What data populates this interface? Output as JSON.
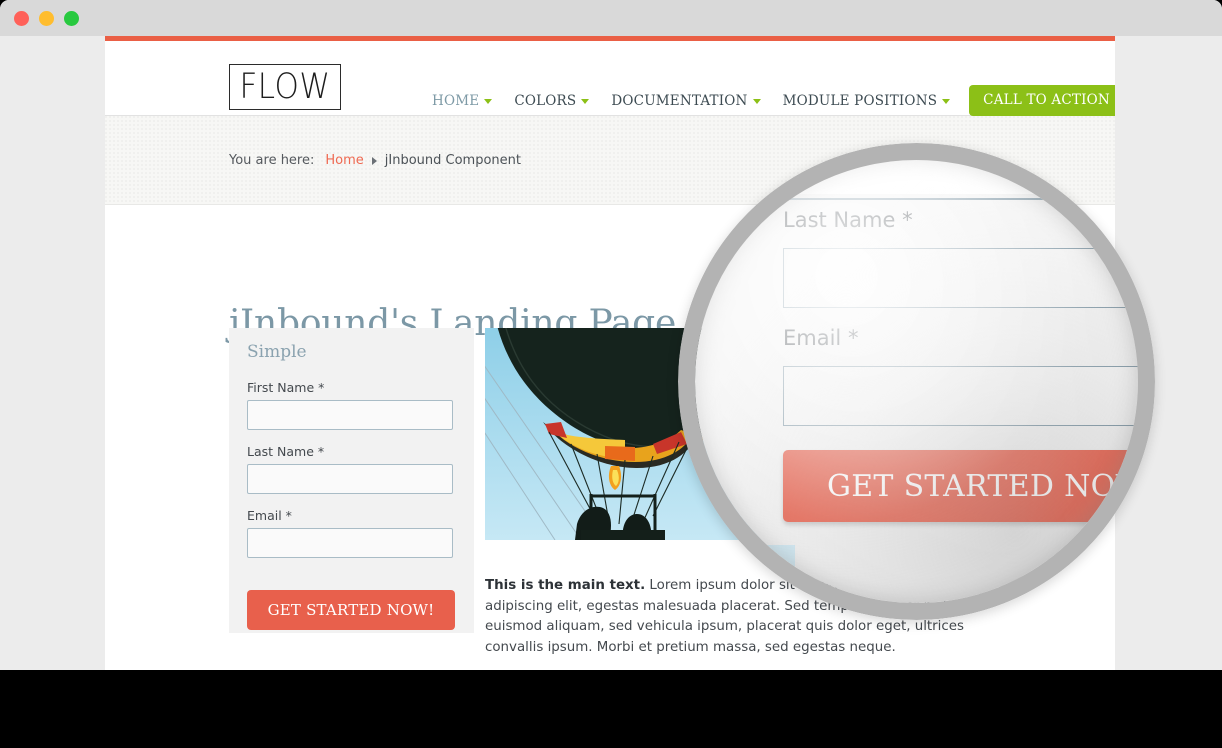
{
  "window": {
    "traffic_lights": [
      {
        "name": "close-button",
        "color": "#ff6159"
      },
      {
        "name": "minimize-button",
        "color": "#ffbd2e"
      },
      {
        "name": "maximize-button",
        "color": "#28c93f"
      }
    ]
  },
  "colors": {
    "accent_orange": "#ea5f45",
    "accent_orange_button": "#e8604c",
    "accent_green": "#8cc017",
    "heading_blue": "#7c98a6",
    "input_border": "#a9bcc6",
    "lens_ring": "#b3b3b3",
    "page_bg": "#ffffff",
    "card_bg": "#f2f2f2",
    "band_bg": "#f7f7f5"
  },
  "header": {
    "logo_text": "FLOW",
    "nav": [
      {
        "label": "HOME",
        "has_caret": true,
        "active": true
      },
      {
        "label": "COLORS",
        "has_caret": true,
        "active": false
      },
      {
        "label": "DOCUMENTATION",
        "has_caret": true,
        "active": false
      },
      {
        "label": "MODULE POSITIONS",
        "has_caret": true,
        "active": false
      }
    ],
    "cta_label": "CALL TO ACTION"
  },
  "breadcrumb": {
    "lead": "You are here:",
    "link": "Home",
    "current": "jInbound Component"
  },
  "main": {
    "page_title": "jInbound's Landing Page",
    "body_copy_lead": "This is the main text.",
    "body_copy": " Lorem ipsum dolor sit amet, consectetur adipiscing elit, egestas malesuada placerat. Sed tempor lacus et nisl euismod aliquam, sed vehicula ipsum, placerat quis dolor eget, ultrices convallis ipsum. Morbi et pretium massa, sed egestas neque.",
    "hero_image_alt": "hot-air-balloon-photo"
  },
  "form": {
    "heading": "Simple",
    "fields": [
      {
        "label": "First Name",
        "required_mark": "*",
        "value": "",
        "placeholder": ""
      },
      {
        "label": "Last Name",
        "required_mark": "*",
        "value": "",
        "placeholder": ""
      },
      {
        "label": "Email",
        "required_mark": "*",
        "value": "",
        "placeholder": ""
      }
    ],
    "submit_label": "GET STARTED NOW!"
  },
  "magnifier": {
    "shows": "form-fields-zoomed",
    "labels": [
      {
        "label": "Last Name",
        "required_mark": "*"
      },
      {
        "label": "Email",
        "required_mark": "*"
      }
    ],
    "button_label": "GET STARTED NOW!"
  }
}
